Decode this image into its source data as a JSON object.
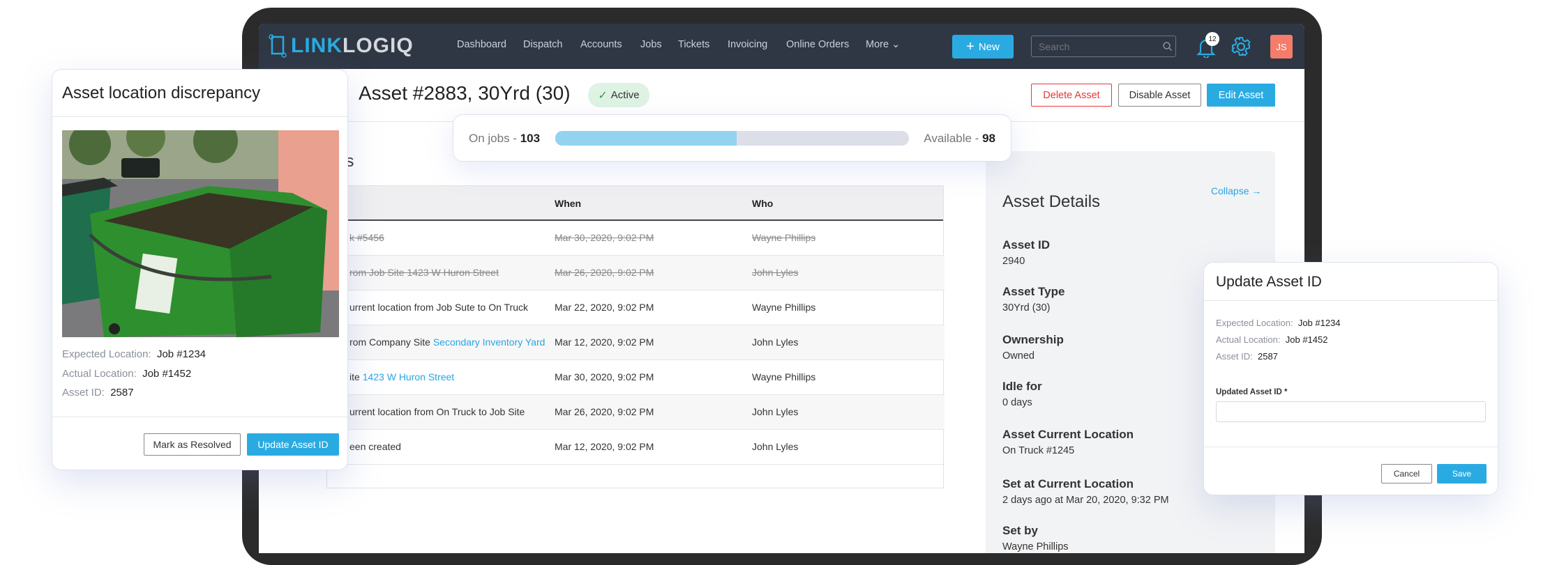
{
  "nav": {
    "logo_text_a": "LINK",
    "logo_text_b": "LOGIQ",
    "items": [
      "Dashboard",
      "Dispatch",
      "Accounts",
      "Jobs",
      "Tickets",
      "Invoicing",
      "Online Orders",
      "More"
    ],
    "new_label": "New",
    "search_placeholder": "Search",
    "notification_count": "12",
    "avatar_initials": "JS"
  },
  "header": {
    "title": "Asset #2883, 30Yrd (30)",
    "status": "Active",
    "delete_label": "Delete Asset",
    "disable_label": "Disable Asset",
    "edit_label": "Edit Asset"
  },
  "availability": {
    "on_jobs_label": "On jobs - ",
    "on_jobs": "103",
    "available_label": "Available - ",
    "available": "98",
    "fill_fraction": 0.512
  },
  "history": {
    "heading_fragment": "es",
    "columns": [
      "When",
      "Who"
    ],
    "rows": [
      {
        "text": "k #5456",
        "link": "",
        "when": "Mar 30, 2020, 9:02 PM",
        "who": "Wayne Phillips",
        "struck": true
      },
      {
        "text": "rom Job Site 1423 W Huron Street",
        "link": "",
        "when": "Mar 26, 2020, 9:02 PM",
        "who": "John Lyles",
        "struck": true
      },
      {
        "text": "urrent location from Job Sute to On Truck",
        "link": "",
        "when": "Mar 22, 2020, 9:02 PM",
        "who": "Wayne Phillips",
        "struck": false
      },
      {
        "text": "rom Company Site ",
        "link": "Secondary Inventory Yard",
        "when": "Mar 12, 2020, 9:02 PM",
        "who": "John Lyles",
        "struck": false
      },
      {
        "text": "ite ",
        "link": "1423 W Huron Street",
        "when": "Mar 30, 2020, 9:02 PM",
        "who": "Wayne Phillips",
        "struck": false
      },
      {
        "text": "urrent location from On Truck to Job Site",
        "link": "",
        "when": "Mar 26, 2020, 9:02 PM",
        "who": "John Lyles",
        "struck": false
      },
      {
        "text": "een created",
        "link": "",
        "when": "Mar 12, 2020, 9:02 PM",
        "who": "John Lyles",
        "struck": false
      }
    ]
  },
  "details": {
    "title": "Asset Details",
    "collapse_label": "Collapse →",
    "fields": [
      {
        "label": "Asset ID",
        "value": "2940",
        "link": true
      },
      {
        "label": "Asset Type",
        "value": "30Yrd (30)",
        "link": true
      },
      {
        "label": "Ownership",
        "value": "Owned",
        "link": false
      },
      {
        "label": "Idle for",
        "value": "0 days",
        "link": false
      },
      {
        "label": "Asset Current Location",
        "value": "On Truck #1245",
        "link": true
      },
      {
        "label": "Set at Current Location",
        "value": "2 days ago at Mar 20, 2020, 9:32 PM",
        "link": false
      },
      {
        "label": "Set by",
        "value": "Wayne Phillips",
        "link": true
      }
    ]
  },
  "discrepancy_card": {
    "title": "Asset location discrepancy",
    "expected_label": "Expected Location:",
    "expected_value": "Job #1234",
    "actual_label": "Actual Location:",
    "actual_value": "Job #1452",
    "asset_id_label": "Asset ID:",
    "asset_id_value": "2587",
    "resolve_label": "Mark as Resolved",
    "update_label": "Update Asset ID"
  },
  "update_card": {
    "title": "Update Asset ID",
    "expected_label": "Expected Location:",
    "expected_value": "Job #1234",
    "actual_label": "Actual Location:",
    "actual_value": "Job #1452",
    "asset_id_label": "Asset ID:",
    "asset_id_value": "2587",
    "field_label": "Updated Asset ID *",
    "field_value": "",
    "cancel_label": "Cancel",
    "save_label": "Save"
  },
  "colors": {
    "accent": "#29abe2",
    "nav_bg": "#2f3744",
    "danger": "#e53935",
    "active_bg": "#def3e3",
    "avatar": "#f47c6a"
  }
}
